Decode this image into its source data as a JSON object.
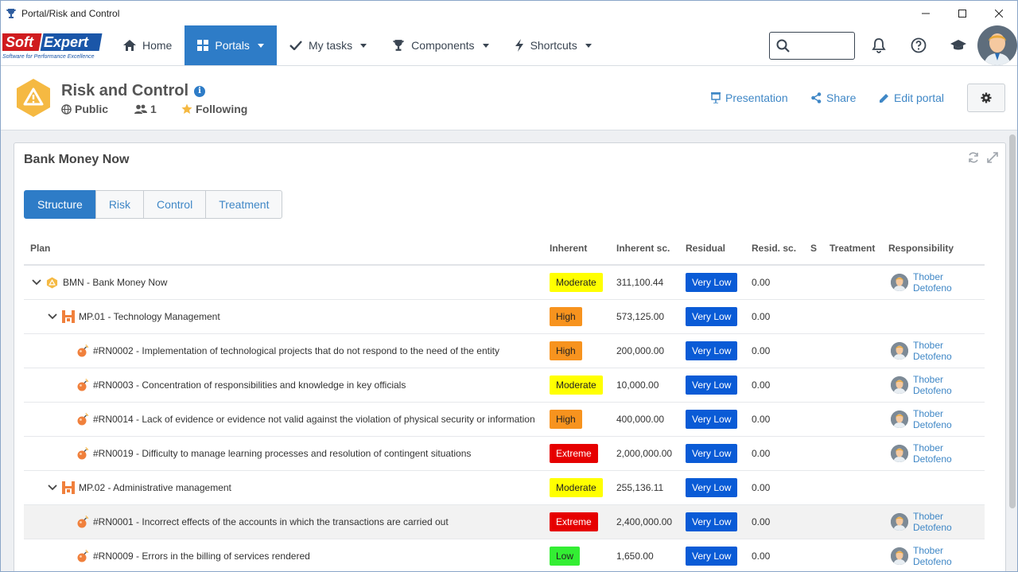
{
  "window": {
    "title": "Portal/Risk and Control",
    "controls": [
      "minimize",
      "maximize",
      "close"
    ]
  },
  "logo": {
    "brand_soft": "Soft",
    "brand_expert": "Expert",
    "tagline": "Software for Performance Excellence"
  },
  "nav": {
    "items": [
      {
        "label": "Home",
        "icon": "home-icon",
        "caret": false
      },
      {
        "label": "Portals",
        "icon": "grid-icon",
        "caret": true,
        "active": true
      },
      {
        "label": "My tasks",
        "icon": "check-icon",
        "caret": true
      },
      {
        "label": "Components",
        "icon": "trophy-icon",
        "caret": true
      },
      {
        "label": "Shortcuts",
        "icon": "bolt-icon",
        "caret": true
      }
    ],
    "search_placeholder": ""
  },
  "portal": {
    "title": "Risk and Control",
    "visibility": "Public",
    "members": "1",
    "following": "Following",
    "actions": {
      "presentation": "Presentation",
      "share": "Share",
      "edit": "Edit portal"
    }
  },
  "panel": {
    "title": "Bank Money Now",
    "tabs": [
      "Structure",
      "Risk",
      "Control",
      "Treatment"
    ],
    "active_tab": "Structure"
  },
  "columns": {
    "plan": "Plan",
    "inherent": "Inherent",
    "inherent_sc": "Inherent sc.",
    "residual": "Residual",
    "resid_sc": "Resid. sc.",
    "s": "S",
    "treatment": "Treatment",
    "responsibility": "Responsibility"
  },
  "level_colors": {
    "Moderate": "#ffff00",
    "High": "#f7931e",
    "Extreme": "#e60000",
    "Low": "#33ee33",
    "Very Low": "#0a5bd6"
  },
  "rows": [
    {
      "plan": "BMN - Bank Money Now",
      "level": 0,
      "kind": "portal",
      "expand": true,
      "inherent": "Moderate",
      "inherent_sc": "311,100.44",
      "residual": "Very Low",
      "resid_sc": "0.00",
      "responsibility": "Thober Detofeno"
    },
    {
      "plan": "MP.01 - Technology Management",
      "level": 1,
      "kind": "process",
      "expand": true,
      "inherent": "High",
      "inherent_sc": "573,125.00",
      "residual": "Very Low",
      "resid_sc": "0.00",
      "responsibility": ""
    },
    {
      "plan": "#RN0002 - Implementation of technological projects that do not respond to the need of the entity",
      "level": 2,
      "kind": "risk",
      "expand": false,
      "inherent": "High",
      "inherent_sc": "200,000.00",
      "residual": "Very Low",
      "resid_sc": "0.00",
      "responsibility": "Thober Detofeno"
    },
    {
      "plan": "#RN0003 - Concentration of responsibilities and knowledge in key officials",
      "level": 2,
      "kind": "risk",
      "expand": false,
      "inherent": "Moderate",
      "inherent_sc": "10,000.00",
      "residual": "Very Low",
      "resid_sc": "0.00",
      "responsibility": "Thober Detofeno"
    },
    {
      "plan": "#RN0014 - Lack of evidence or evidence not valid against the violation of physical security or information",
      "level": 2,
      "kind": "risk",
      "expand": false,
      "inherent": "High",
      "inherent_sc": "400,000.00",
      "residual": "Very Low",
      "resid_sc": "0.00",
      "responsibility": "Thober Detofeno"
    },
    {
      "plan": "#RN0019 - Difficulty to manage learning processes and resolution of contingent situations",
      "level": 2,
      "kind": "risk",
      "expand": false,
      "inherent": "Extreme",
      "inherent_sc": "2,000,000.00",
      "residual": "Very Low",
      "resid_sc": "0.00",
      "responsibility": "Thober Detofeno"
    },
    {
      "plan": "MP.02 - Administrative management",
      "level": 1,
      "kind": "process",
      "expand": true,
      "inherent": "Moderate",
      "inherent_sc": "255,136.11",
      "residual": "Very Low",
      "resid_sc": "0.00",
      "responsibility": ""
    },
    {
      "plan": "#RN0001 - Incorrect effects of the accounts in which the transactions are carried out",
      "level": 2,
      "kind": "risk",
      "expand": false,
      "inherent": "Extreme",
      "inherent_sc": "2,400,000.00",
      "residual": "Very Low",
      "resid_sc": "0.00",
      "responsibility": "Thober Detofeno",
      "highlight": true
    },
    {
      "plan": "#RN0009 - Errors in the billing of services rendered",
      "level": 2,
      "kind": "risk",
      "expand": false,
      "inherent": "Low",
      "inherent_sc": "1,650.00",
      "residual": "Very Low",
      "resid_sc": "0.00",
      "responsibility": "Thober Detofeno"
    }
  ]
}
